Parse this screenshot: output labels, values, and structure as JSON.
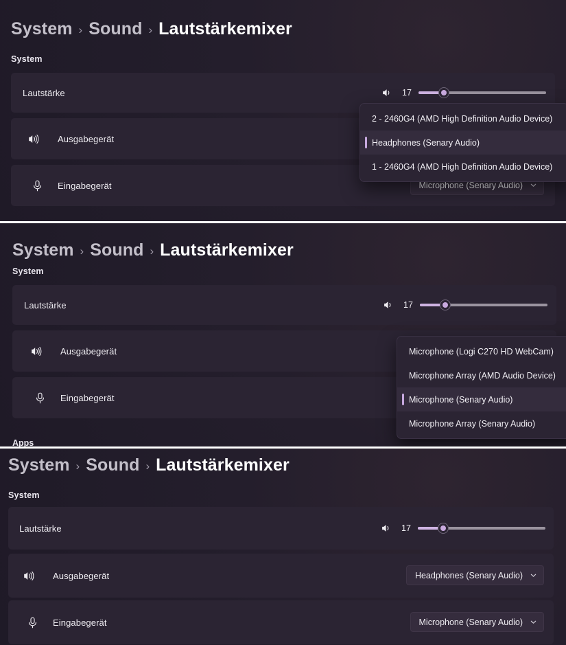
{
  "breadcrumb": {
    "root": "System",
    "separator": "›",
    "parent": "Sound",
    "current": "Lautstärkemixer"
  },
  "section": {
    "label": "System",
    "apps_label": "Apps"
  },
  "colors": {
    "background": "#1f1a27",
    "card": "#2b2433",
    "accent": "#c9aadf",
    "slider_fill": "#ceb3e2",
    "slider_track": "#9a939f",
    "selection_bar": "#c6a8de",
    "text_primary": "#eeecf1",
    "text_muted": "#c3bfc9",
    "flyout_bg": "#2b2433",
    "flyout_selected": "#342c3d",
    "separator": "#ffffff"
  },
  "rows": {
    "volume": {
      "label": "Lautstärke",
      "icon": "speaker-icon",
      "value": "17",
      "value_number": 17,
      "min": 0,
      "max": 100,
      "fill_percent": 20
    },
    "output": {
      "label": "Ausgabegerät",
      "icon": "speaker-waves-icon",
      "value": "Headphones (Senary Audio)",
      "chevron": "chevron-down-icon"
    },
    "input": {
      "label": "Eingabegerät",
      "icon": "microphone-icon",
      "value": "Microphone (Senary Audio)",
      "chevron": "chevron-down-icon"
    }
  },
  "panels": [
    {
      "id": "panel-1",
      "flyout": {
        "name": "output-device-dropdown",
        "items": [
          {
            "label": "2 - 2460G4 (AMD High Definition Audio Device)",
            "selected": false
          },
          {
            "label": "Headphones (Senary Audio)",
            "selected": true
          },
          {
            "label": "1 - 2460G4 (AMD High Definition Audio Device)",
            "selected": false
          }
        ]
      }
    },
    {
      "id": "panel-2",
      "flyout": {
        "name": "input-device-dropdown",
        "items": [
          {
            "label": "Microphone (Logi C270 HD WebCam)",
            "selected": false
          },
          {
            "label": "Microphone Array (AMD Audio Device)",
            "selected": false
          },
          {
            "label": "Microphone (Senary Audio)",
            "selected": true
          },
          {
            "label": "Microphone Array (Senary Audio)",
            "selected": false
          }
        ]
      }
    },
    {
      "id": "panel-3",
      "flyout": null
    }
  ]
}
